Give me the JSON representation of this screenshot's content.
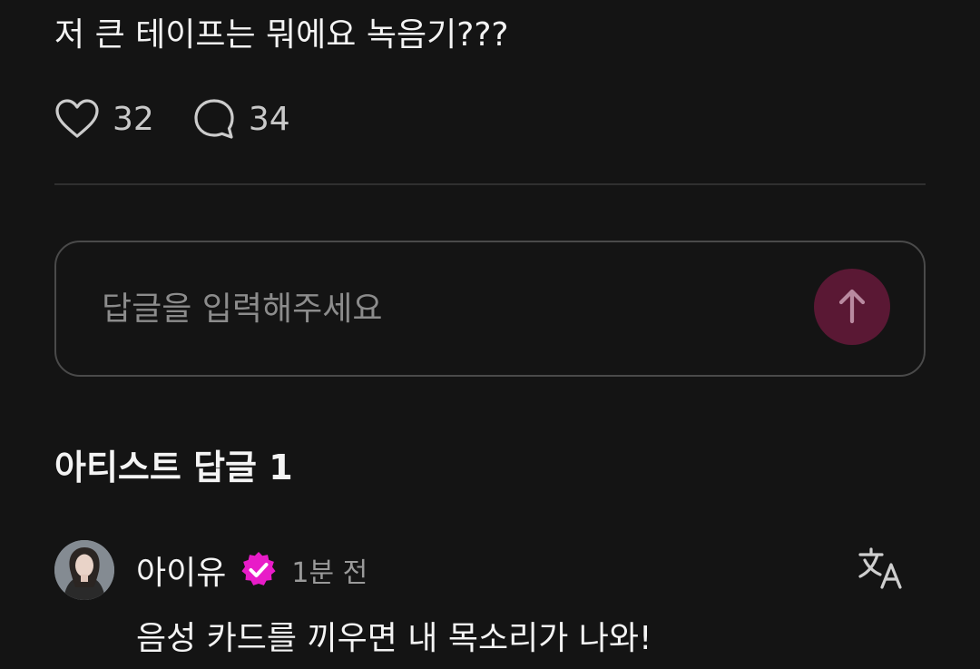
{
  "post": {
    "text": "저 큰 테이프는 뭐에요 녹음기???",
    "like_count": "32",
    "comment_count": "34",
    "like_icon": "heart-outline-icon",
    "comment_icon": "speech-bubble-icon"
  },
  "reply_input": {
    "placeholder": "답글을 입력해주세요",
    "value": "",
    "send_icon": "arrow-up-icon",
    "send_button_color": "#5a1834"
  },
  "artist_replies": {
    "title": "아티스트 답글 1",
    "items": [
      {
        "author": "아이유",
        "verified_icon": "verified-badge-icon",
        "verified_color": "#e81cc8",
        "time": "1분 전",
        "text": "음성 카드를 끼우면 내 목소리가 나와!",
        "translate_icon": "translate-icon"
      }
    ]
  },
  "colors": {
    "background": "#141414",
    "text": "#f4f4f4",
    "muted_text": "#9a9a9a",
    "divider": "#2f2f2f",
    "input_border": "#4a4a4a"
  }
}
